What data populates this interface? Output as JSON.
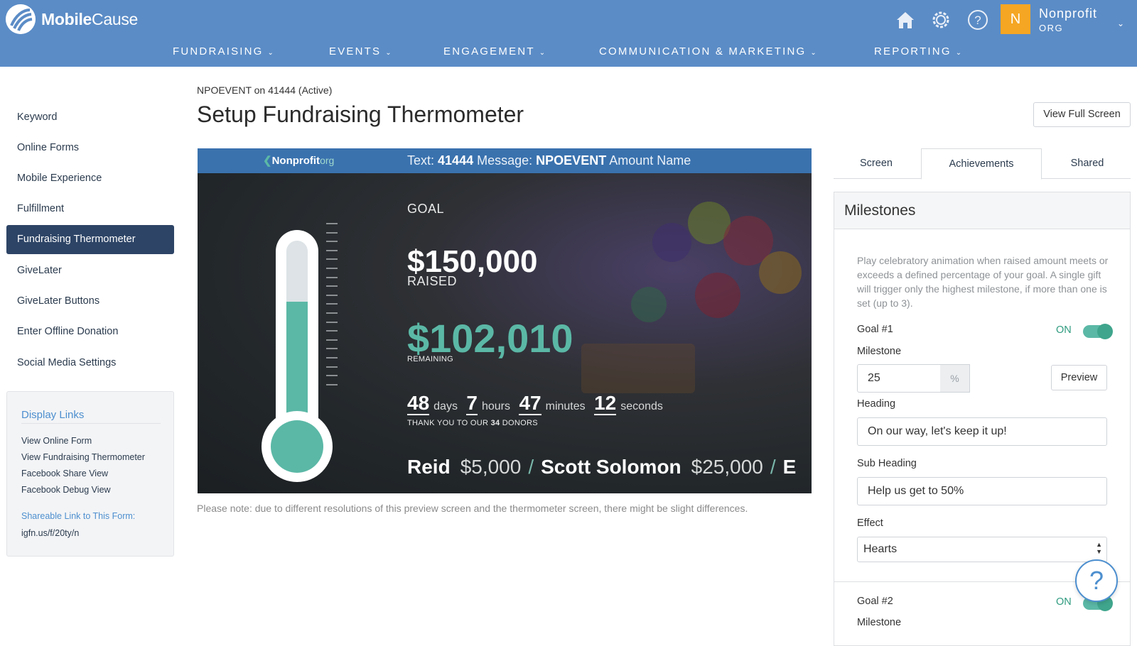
{
  "header": {
    "brand": "MobileCause",
    "brand_bold": "Mobile",
    "brand_light": "Cause",
    "avatar_letter": "N",
    "org_name": "Nonprofit",
    "org_sub": "ORG",
    "icons": [
      "home-icon",
      "gear-icon",
      "question-icon"
    ],
    "nav": [
      "FUNDRAISING",
      "EVENTS",
      "ENGAGEMENT",
      "COMMUNICATION & MARKETING",
      "REPORTING"
    ]
  },
  "sidebar": {
    "items": [
      "Keyword",
      "Online Forms",
      "Mobile Experience",
      "Fulfillment",
      "Fundraising Thermometer",
      "GiveLater",
      "GiveLater Buttons",
      "Enter Offline Donation",
      "Social Media Settings"
    ],
    "active_index": 4,
    "display_links": {
      "title": "Display Links",
      "links": [
        "View Online Form",
        "View Fundraising Thermometer",
        "Facebook Share View",
        "Facebook Debug View"
      ],
      "share_label": "Shareable Link to This Form:",
      "share_url": "igfn.us/f/20ty/n"
    }
  },
  "main": {
    "breadcrumb": "NPOEVENT on 41444 (Active)",
    "title": "Setup Fundraising Thermometer",
    "view_full_screen": "View Full Screen",
    "note": "Please note: due to different resolutions of this preview screen and the thermometer screen, there might be slight differences."
  },
  "preview": {
    "logo_name": "Nonprofit",
    "logo_suffix": "org",
    "text_prefix": "Text:",
    "short_code": "41444",
    "message_label": "Message:",
    "keyword": "NPOEVENT",
    "amount_name": "Amount Name",
    "goal_label": "GOAL",
    "goal": "$150,000",
    "raised_label": "RAISED",
    "raised": "$102,010",
    "progress_fraction": 0.68,
    "remaining_label": "REMAINING",
    "countdown": [
      {
        "value": "48",
        "unit": "days"
      },
      {
        "value": "7",
        "unit": "hours"
      },
      {
        "value": "47",
        "unit": "minutes"
      },
      {
        "value": "12",
        "unit": "seconds"
      }
    ],
    "donors_prefix": "THANK YOU TO OUR",
    "donor_count": "34",
    "donors_suffix": "DONORS",
    "donors": [
      {
        "name": "Reid",
        "amount": "$5,000"
      },
      {
        "name": "Scott Solomon",
        "amount": "$25,000"
      },
      {
        "name": "E",
        "amount": ""
      }
    ]
  },
  "right_panel": {
    "tabs": [
      "Screen",
      "Achievements",
      "Shared"
    ],
    "active_tab": "Achievements",
    "title": "Milestones",
    "help": "Play celebratory animation when raised amount meets or exceeds a defined percentage of your goal. A single gift will trigger only the highest milestone, if more than one is set (up to 3).",
    "goal1_label": "Goal #1",
    "goal1_state": "ON",
    "milestone_label": "Milestone",
    "milestone_value": "25",
    "percent_addon": "%",
    "preview_btn": "Preview",
    "heading_label": "Heading",
    "heading_value": "On our way, let's keep it up!",
    "subheading_label": "Sub Heading",
    "subheading_value": "Help us get to 50%",
    "effect_label": "Effect",
    "effect_value": "Hearts",
    "goal2_label": "Goal #2",
    "goal2_state": "ON",
    "milestone2_label": "Milestone"
  },
  "help_fab": "?",
  "colors": {
    "header": "#5b8cc6",
    "accent_green": "#5bb8a6",
    "sidebar_active": "#2d4466",
    "link_blue": "#4d8fcf",
    "avatar": "#f5a623"
  }
}
